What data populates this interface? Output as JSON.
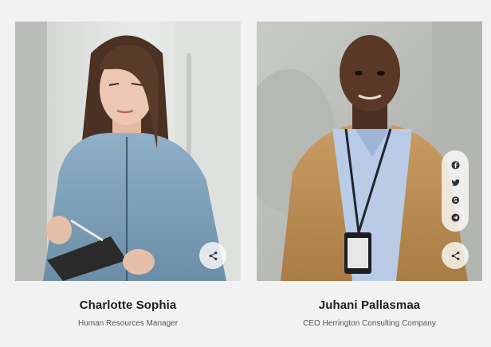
{
  "team": [
    {
      "name": "Charlotte Sophia",
      "role": "Human Resources Manager",
      "share_icon": "share-icon"
    },
    {
      "name": "Juhani Pallasmaa",
      "role": "CEO Herrington Consulting Company",
      "share_icon": "share-icon",
      "social_icons": [
        "facebook-icon",
        "twitter-icon",
        "skype-icon",
        "telegram-icon"
      ]
    }
  ],
  "colors": {
    "background": "#f2f2f2",
    "name_text": "#1d1d1d",
    "role_text": "#555555",
    "button_bg": "#ffffffc7"
  }
}
